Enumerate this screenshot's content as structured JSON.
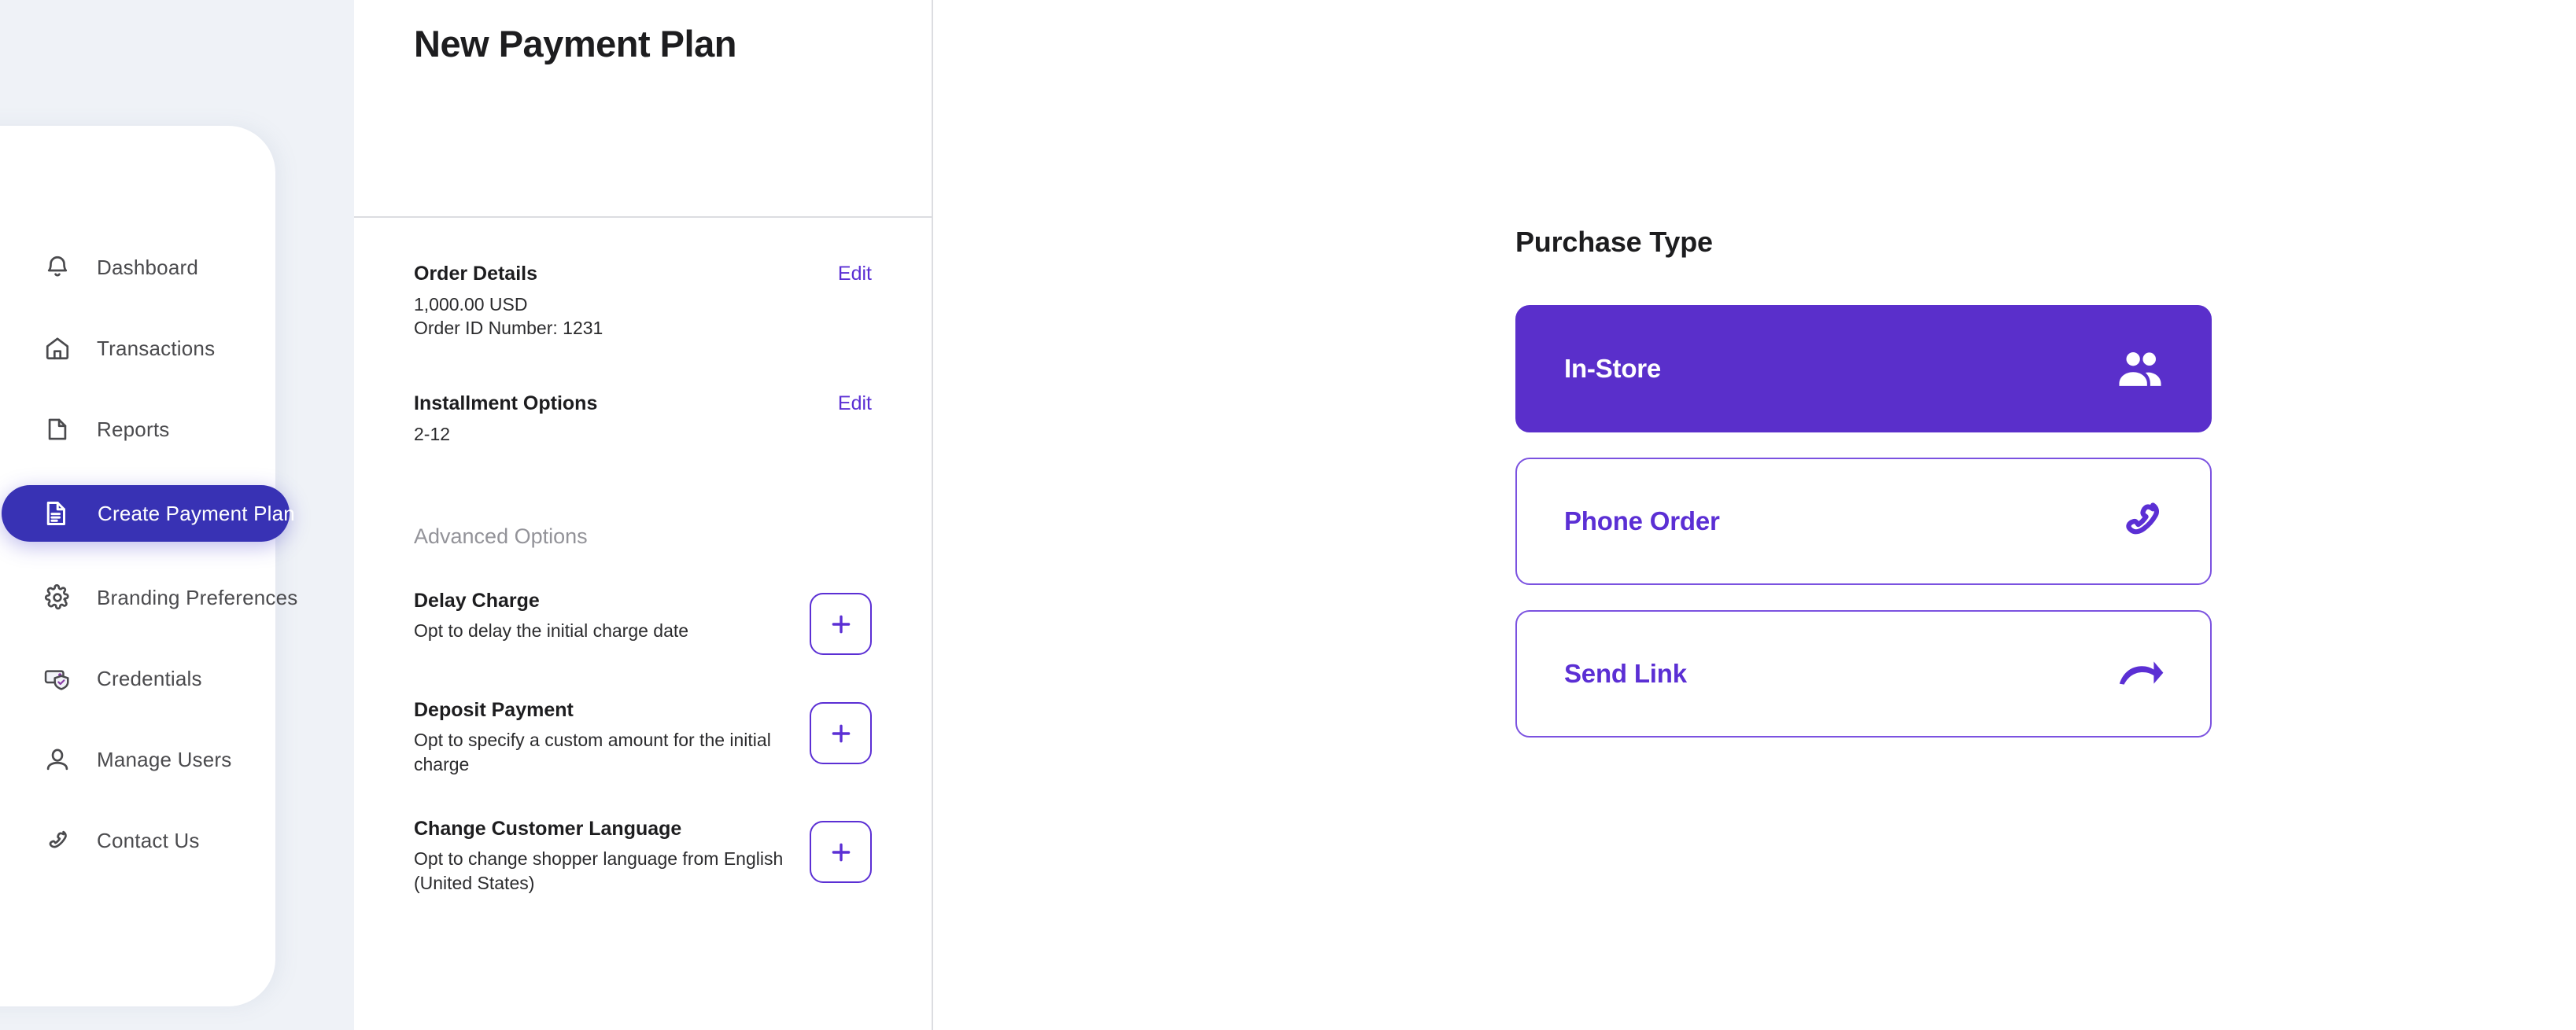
{
  "sidebar": {
    "items": [
      {
        "label": "Dashboard",
        "icon": "bell-icon",
        "active": false
      },
      {
        "label": "Transactions",
        "icon": "home-icon",
        "active": false
      },
      {
        "label": "Reports",
        "icon": "document-icon",
        "active": false
      },
      {
        "label": "Create Payment Plan",
        "icon": "file-text-icon",
        "active": true
      },
      {
        "label": "Branding Preferences",
        "icon": "gear-icon",
        "active": false
      },
      {
        "label": "Credentials",
        "icon": "card-shield-icon",
        "active": false
      },
      {
        "label": "Manage Users",
        "icon": "user-icon",
        "active": false
      },
      {
        "label": "Contact Us",
        "icon": "phone-icon",
        "active": false
      }
    ]
  },
  "main": {
    "page_title": "New Payment Plan",
    "summary": [
      {
        "title": "Order Details",
        "lines": [
          "1,000.00 USD",
          "Order ID Number: 1231"
        ],
        "edit_label": "Edit"
      },
      {
        "title": "Installment Options",
        "lines": [
          "2-12"
        ],
        "edit_label": "Edit"
      }
    ],
    "advanced_header": "Advanced Options",
    "advanced_options": [
      {
        "title": "Delay Charge",
        "description": "Opt to delay the initial charge date",
        "add_icon": "plus-icon"
      },
      {
        "title": "Deposit Payment",
        "description": "Opt to specify a custom amount for the initial charge",
        "add_icon": "plus-icon"
      },
      {
        "title": "Change Customer Language",
        "description": "Opt to change shopper language from English (United States)",
        "add_icon": "plus-icon"
      }
    ]
  },
  "purchase_type": {
    "title": "Purchase Type",
    "options": [
      {
        "label": "In-Store",
        "icon": "people-icon",
        "selected": true
      },
      {
        "label": "Phone Order",
        "icon": "phone-call-icon",
        "selected": false
      },
      {
        "label": "Send Link",
        "icon": "share-arrow-icon",
        "selected": false
      }
    ]
  },
  "colors": {
    "brand_purple": "#5a2fcb",
    "link_purple": "#5b2fd4",
    "sidebar_active": "#3832b4",
    "app_background": "#eff2f7",
    "divider": "#dcdde1"
  }
}
